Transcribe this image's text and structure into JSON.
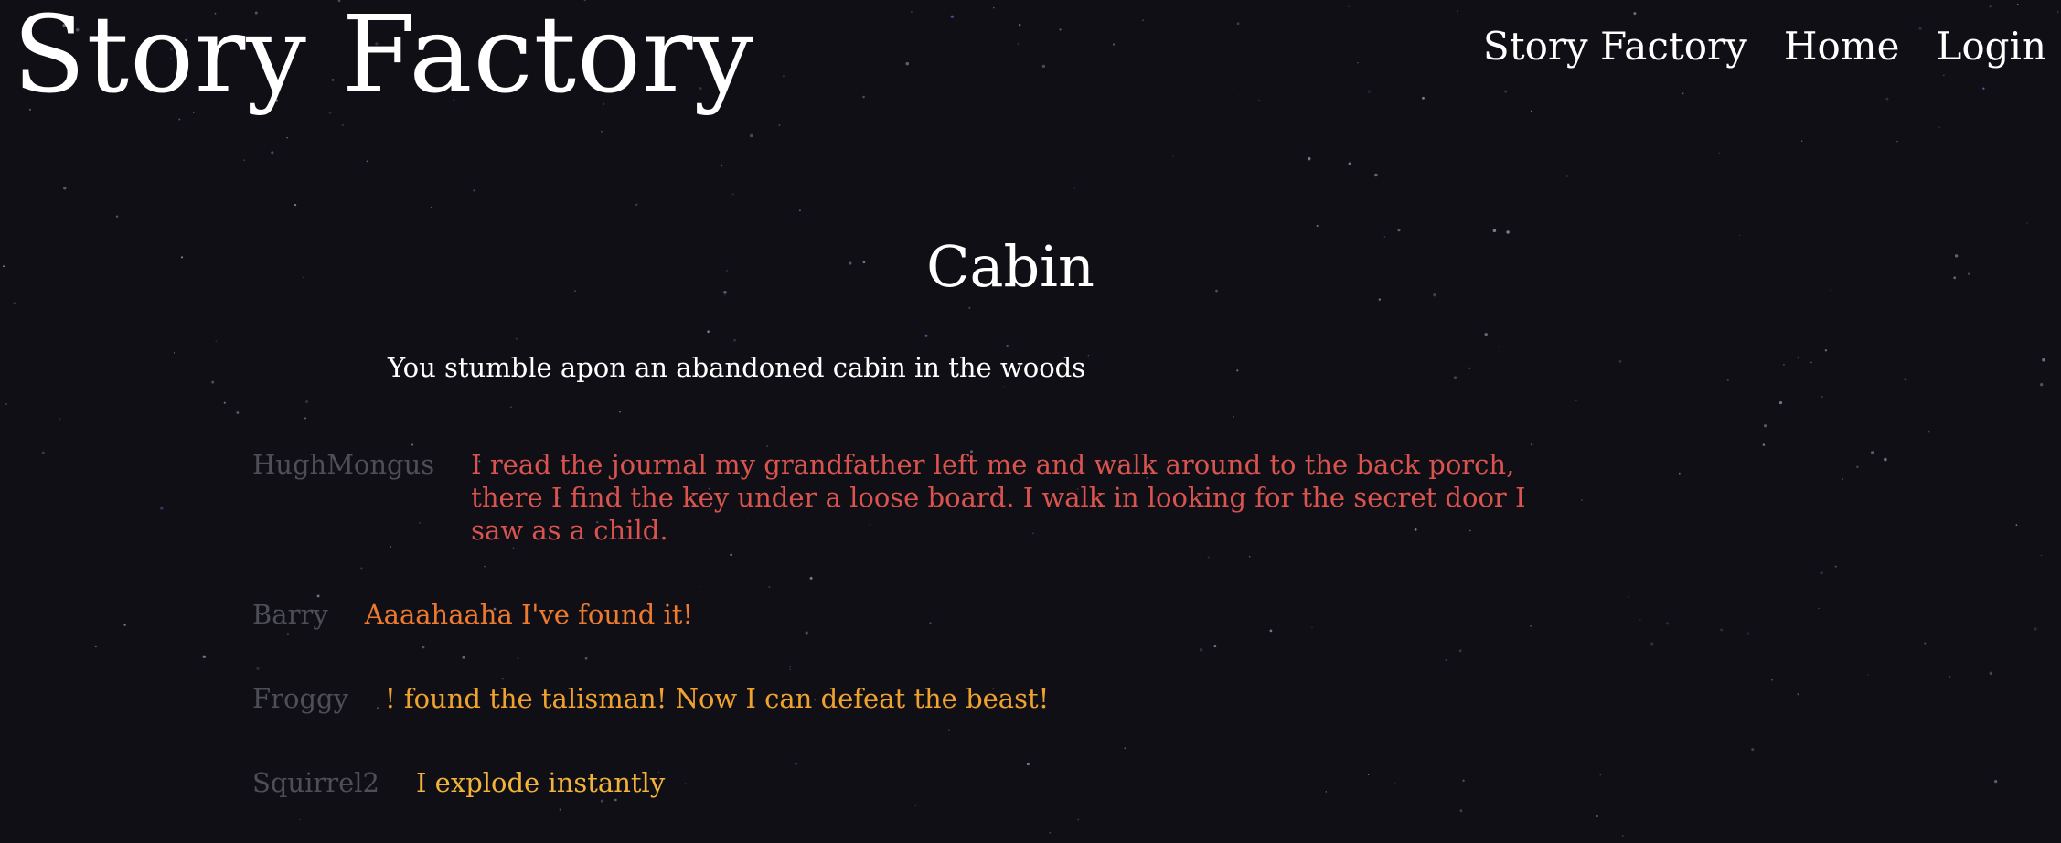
{
  "header": {
    "site_title": "Story Factory",
    "nav": [
      {
        "label": "Story Factory"
      },
      {
        "label": "Home"
      },
      {
        "label": "Login"
      }
    ]
  },
  "story": {
    "title": "Cabin",
    "intro": "You stumble apon an abandoned cabin in the woods",
    "entries": [
      {
        "author": "HughMongus",
        "text": "I read the journal my grandfather left me and walk around to the back porch, there I find the key under a loose board. I walk in looking for the secret door I saw as a child.",
        "color": "#d9534f"
      },
      {
        "author": "Barry",
        "text": "Aaaahaaha I've found it!",
        "color": "#ee7a30"
      },
      {
        "author": "Froggy",
        "text": "! found the talisman! Now I can defeat the beast!",
        "color": "#f0a12e"
      },
      {
        "author": "Squirrel2",
        "text": "I explode instantly",
        "color": "#f2b33a"
      }
    ]
  },
  "theme": {
    "background": "#0f0f15",
    "author_color": "#4e4e58",
    "text_color": "#ffffff"
  }
}
